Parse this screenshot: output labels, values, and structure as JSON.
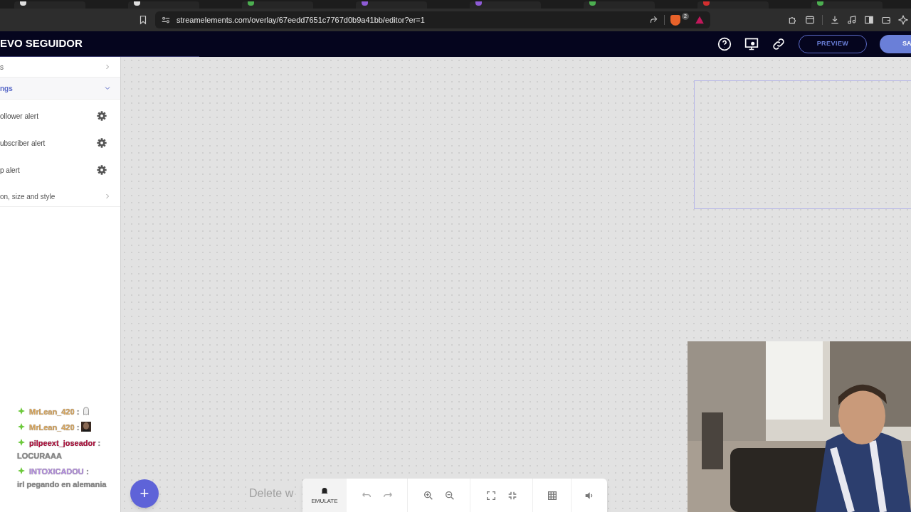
{
  "browser": {
    "url": "streamelements.com/overlay/67eedd7651c7767d0b9a41bb/editor?er=1",
    "shield_badge": "2"
  },
  "header": {
    "title": "EVO SEGUIDOR",
    "buttons": [
      {
        "kind": "outline",
        "label": "PREVIEW"
      },
      {
        "kind": "solid",
        "label": "SA"
      }
    ]
  },
  "sidebar": {
    "sections": [
      {
        "label": "s",
        "expanded": false
      },
      {
        "label": "ngs",
        "expanded": true,
        "children": [
          {
            "label": "ollower alert"
          },
          {
            "label": "ubscriber alert"
          },
          {
            "label": "p alert"
          }
        ]
      },
      {
        "label": "on, size and style",
        "expanded": false
      }
    ]
  },
  "chat": [
    {
      "user": "MrLean_420",
      "separator": ":",
      "color": "#d9a65c",
      "kind": "emote-icon"
    },
    {
      "user": "MrLean_420",
      "separator": ":",
      "color": "#d9a65c",
      "kind": "emote-picture"
    },
    {
      "user": "pilpeext_joseador",
      "separator": ":",
      "color": "#b3123f",
      "kind": "text",
      "text": "LOCURAAA"
    },
    {
      "user": "INTOXICADOU",
      "separator": ":",
      "color": "#b58fe0",
      "kind": "text",
      "text": "irl pegando en alemania"
    }
  ],
  "canvas": {
    "hint": "Delete w",
    "add_button": "+"
  },
  "toolbar": {
    "emulate": "EMULATE"
  }
}
